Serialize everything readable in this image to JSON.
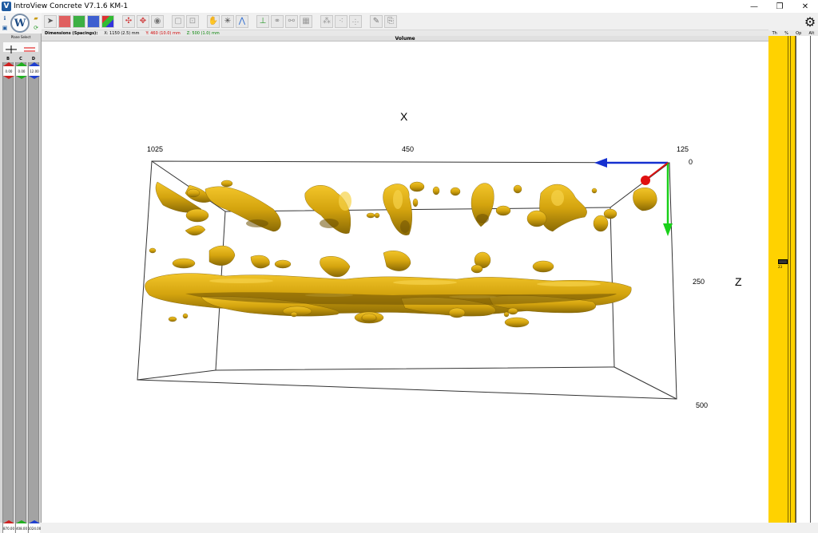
{
  "window": {
    "title": "IntroView Concrete V7.1.6   KM-1",
    "minimize": "—",
    "restore": "❐",
    "close": "✕"
  },
  "info": {
    "label": "Dimensions (Spacings):",
    "x": "X: 1150 (2.5) mm",
    "y": "Y: 460 (10.0) mm",
    "z": "Z: 500 (1.0) mm"
  },
  "view_title": "Volume",
  "left_panel": {
    "plane_label": "Plane Select",
    "columns": [
      "B",
      "C",
      "D"
    ],
    "top_values": [
      "0.00",
      "0.00",
      "12.00"
    ],
    "bottom_values": [
      "870.00",
      "408.00",
      "1024.00"
    ]
  },
  "right_panel": {
    "headers": [
      "Th",
      "%",
      "Op",
      "Alt"
    ],
    "slider_value": "23"
  },
  "volume": {
    "axis_x_label": "X",
    "axis_z_label": "Z",
    "x_ticks": [
      "1025",
      "450",
      "125"
    ],
    "z_ticks": [
      "0",
      "250",
      "500"
    ],
    "colors": {
      "isosurface": "#d8a90f",
      "isosurface_dark": "#8a6a05",
      "axis_x": "#1530d0",
      "axis_y": "#e01010",
      "axis_z": "#19d019"
    }
  }
}
